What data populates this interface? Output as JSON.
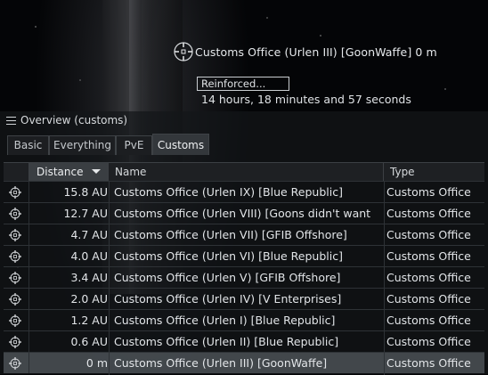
{
  "space_target": {
    "label": "Customs Office (Urlen III) [GoonWaffe] 0 m",
    "status_box": "Reinforced...",
    "timer": "14 hours, 18 minutes and 57 seconds"
  },
  "overview": {
    "title": "Overview (customs)",
    "tabs": [
      {
        "label": "Basic"
      },
      {
        "label": "Everything"
      },
      {
        "label": "PvE"
      },
      {
        "label": "Customs"
      }
    ],
    "active_tab": "Customs",
    "columns": {
      "distance": "Distance",
      "name": "Name",
      "type": "Type"
    },
    "rows": [
      {
        "distance": "15.8 AU",
        "name": "Customs Office (Urlen IX) [Blue Republic]",
        "type": "Customs Office"
      },
      {
        "distance": "12.7 AU",
        "name": "Customs Office (Urlen VIII) [Goons didn't want",
        "type": "Customs Office"
      },
      {
        "distance": "4.7 AU",
        "name": "Customs Office (Urlen VII) [GFIB Offshore]",
        "type": "Customs Office"
      },
      {
        "distance": "4.0 AU",
        "name": "Customs Office (Urlen VI) [Blue Republic]",
        "type": "Customs Office"
      },
      {
        "distance": "3.4 AU",
        "name": "Customs Office (Urlen V) [GFIB Offshore]",
        "type": "Customs Office"
      },
      {
        "distance": "2.0 AU",
        "name": "Customs Office (Urlen IV) [V Enterprises]",
        "type": "Customs Office"
      },
      {
        "distance": "1.2 AU",
        "name": "Customs Office (Urlen I) [Blue Republic]",
        "type": "Customs Office"
      },
      {
        "distance": "0.6 AU",
        "name": "Customs Office (Urlen II) [Blue Republic]",
        "type": "Customs Office"
      },
      {
        "distance": "0 m",
        "name": "Customs Office (Urlen III) [GoonWaffe]",
        "type": "Customs Office",
        "selected": true
      }
    ]
  },
  "icons": {
    "target_bracket": "structure-bracket-icon",
    "row_icon": "customs-office-bracket-icon",
    "menu": "hamburger-menu-icon",
    "sort": "sort-descending-icon"
  }
}
